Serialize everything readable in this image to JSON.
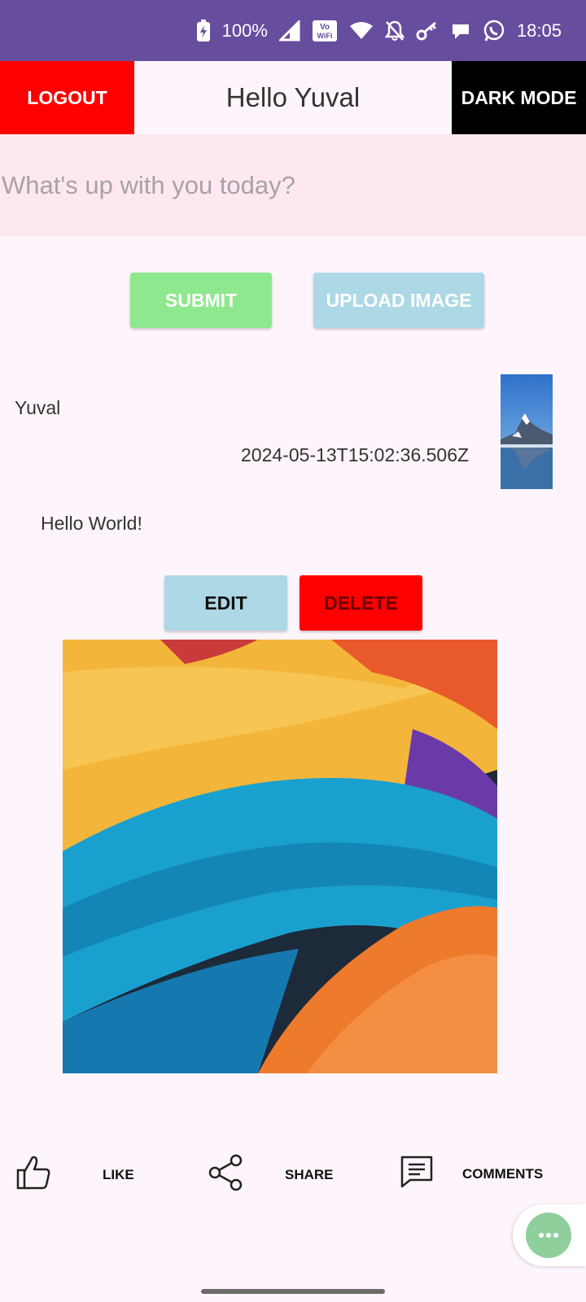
{
  "status_bar": {
    "battery": "100%",
    "time": "18:05",
    "volte_label": "Vo» WiFi"
  },
  "header": {
    "logout_label": "LOGOUT",
    "greeting": "Hello Yuval",
    "dark_mode_label": "DARK MODE"
  },
  "compose": {
    "placeholder": "What's up with you today?",
    "value": "",
    "submit_label": "SUBMIT",
    "upload_label": "UPLOAD IMAGE"
  },
  "post": {
    "author": "Yuval",
    "timestamp": "2024-05-13T15:02:36.506Z",
    "text": "Hello World!",
    "edit_label": "EDIT",
    "delete_label": "DELETE"
  },
  "actions": {
    "like_label": "LIKE",
    "share_label": "SHARE",
    "comments_label": "COMMENTS"
  },
  "colors": {
    "status_bar": "#674d9e",
    "logout": "#ff0000",
    "dark_mode": "#000000",
    "submit": "#8ee88e",
    "upload": "#add8e6",
    "edit": "#add8e6",
    "delete": "#ff0000",
    "chat_fab": "#8fcf9b"
  },
  "icons": {
    "battery": "battery-charging-icon",
    "signal": "signal-icon",
    "vowifi": "vowifi-icon",
    "wifi": "wifi-icon",
    "mute": "bell-off-icon",
    "key": "key-icon",
    "chat_status": "chat-bubble-icon",
    "whatsapp": "whatsapp-icon",
    "like": "thumbs-up-icon",
    "share": "share-icon",
    "comments": "comment-icon",
    "chat_fab": "chat-dots-icon"
  }
}
